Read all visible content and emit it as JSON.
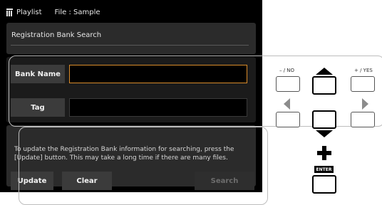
{
  "titlebar": {
    "playlist": "Playlist",
    "file": "File : Sample"
  },
  "panel": {
    "title": "Registration Bank Search"
  },
  "form": {
    "bank_name_label": "Bank Name",
    "bank_name_value": "",
    "tag_label": "Tag",
    "tag_value": ""
  },
  "info": {
    "message": "To update the Registration Bank information for searching, press the [Update] button. This may take a long time if there are many files."
  },
  "buttons": {
    "update": "Update",
    "clear": "Clear",
    "search": "Search"
  },
  "panel_buttons": {
    "no_label": "– / NO",
    "yes_label": "+ / YES",
    "enter_label": "ENTER"
  },
  "colors": {
    "focus_border": "#d98b2a",
    "screen_bg": "#000000"
  }
}
